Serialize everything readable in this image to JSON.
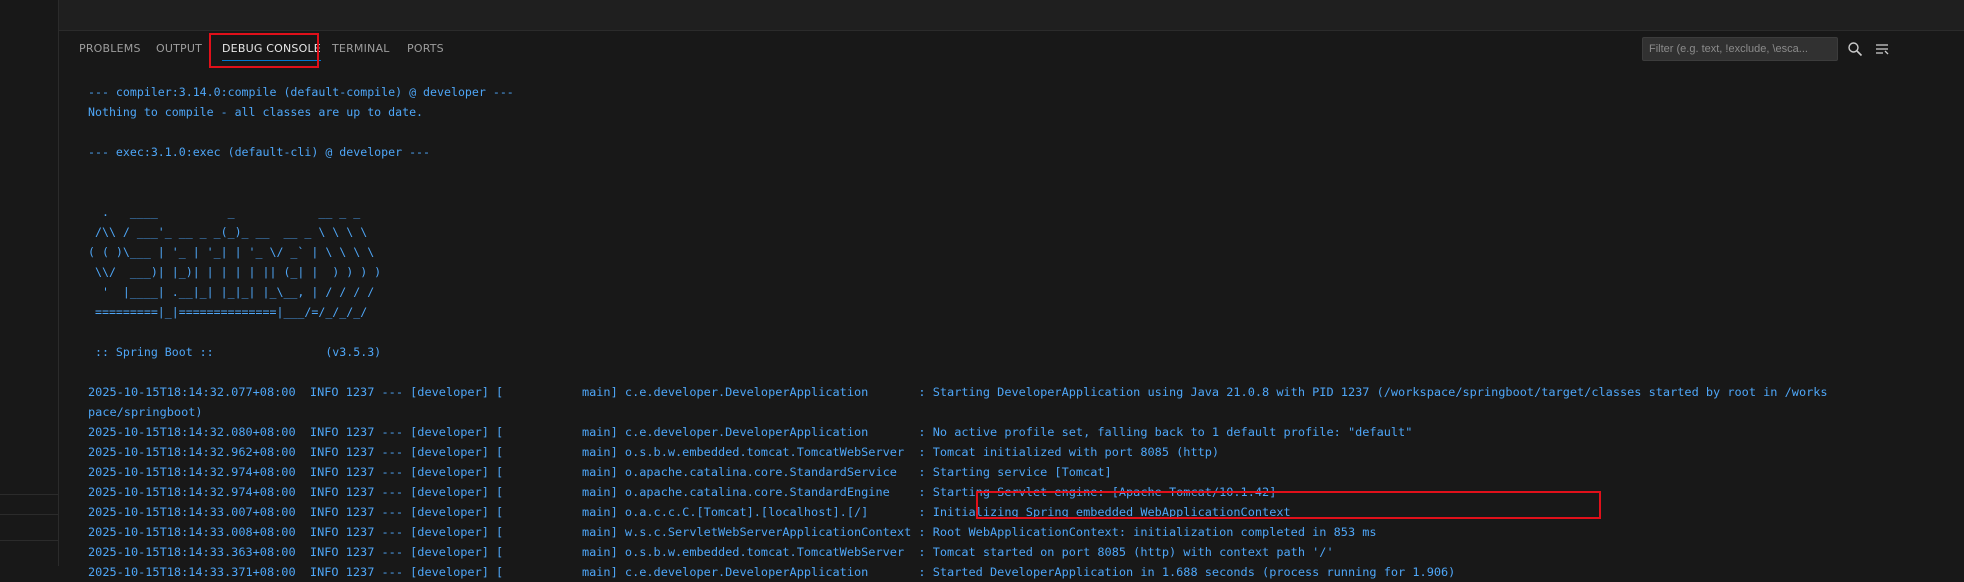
{
  "tabs": [
    {
      "label": "PROBLEMS"
    },
    {
      "label": "OUTPUT"
    },
    {
      "label": "DEBUG CONSOLE"
    },
    {
      "label": "TERMINAL"
    },
    {
      "label": "PORTS"
    }
  ],
  "filter": {
    "placeholder": "Filter (e.g. text, !exclude, \\esca..."
  },
  "toolbar": {
    "icons": [
      "search-icon",
      "word-wrap-icon",
      "maximize-icon",
      "close-icon"
    ]
  },
  "console": {
    "lines": [
      "--- compiler:3.14.0:compile (default-compile) @ developer ---",
      "Nothing to compile - all classes are up to date.",
      "",
      "--- exec:3.1.0:exec (default-cli) @ developer ---",
      "",
      "",
      "  .   ____          _            __ _ _",
      " /\\\\ / ___'_ __ _ _(_)_ __  __ _ \\ \\ \\ \\",
      "( ( )\\___ | '_ | '_| | '_ \\/ _` | \\ \\ \\ \\",
      " \\\\/  ___)| |_)| | | | | || (_| |  ) ) ) )",
      "  '  |____| .__|_| |_|_| |_\\__, | / / / /",
      " =========|_|==============|___/=/_/_/_/",
      "",
      " :: Spring Boot ::                (v3.5.3)",
      "",
      "2025-10-15T18:14:32.077+08:00  INFO 1237 --- [developer] [           main] c.e.developer.DeveloperApplication       : Starting DeveloperApplication using Java 21.0.8 with PID 1237 (/workspace/springboot/target/classes started by root in /works",
      "pace/springboot)",
      "2025-10-15T18:14:32.080+08:00  INFO 1237 --- [developer] [           main] c.e.developer.DeveloperApplication       : No active profile set, falling back to 1 default profile: \"default\"",
      "2025-10-15T18:14:32.962+08:00  INFO 1237 --- [developer] [           main] o.s.b.w.embedded.tomcat.TomcatWebServer  : Tomcat initialized with port 8085 (http)",
      "2025-10-15T18:14:32.974+08:00  INFO 1237 --- [developer] [           main] o.apache.catalina.core.StandardService   : Starting service [Tomcat]",
      "2025-10-15T18:14:32.974+08:00  INFO 1237 --- [developer] [           main] o.apache.catalina.core.StandardEngine    : Starting Servlet engine: [Apache Tomcat/10.1.42]",
      "2025-10-15T18:14:33.007+08:00  INFO 1237 --- [developer] [           main] o.a.c.c.C.[Tomcat].[localhost].[/]       : Initializing Spring embedded WebApplicationContext",
      "2025-10-15T18:14:33.008+08:00  INFO 1237 --- [developer] [           main] w.s.c.ServletWebServerApplicationContext : Root WebApplicationContext: initialization completed in 853 ms",
      "2025-10-15T18:14:33.363+08:00  INFO 1237 --- [developer] [           main] o.s.b.w.embedded.tomcat.TomcatWebServer  : Tomcat started on port 8085 (http) with context path '/'",
      "2025-10-15T18:14:33.371+08:00  INFO 1237 --- [developer] [           main] c.e.developer.DeveloperApplication       : Started DeveloperApplication in 1.688 seconds (process running for 1.906)"
    ]
  },
  "colors": {
    "accent": "#0078d4",
    "console_text": "#4ea6f7",
    "highlight_box": "#e0101a",
    "background": "#181818"
  }
}
